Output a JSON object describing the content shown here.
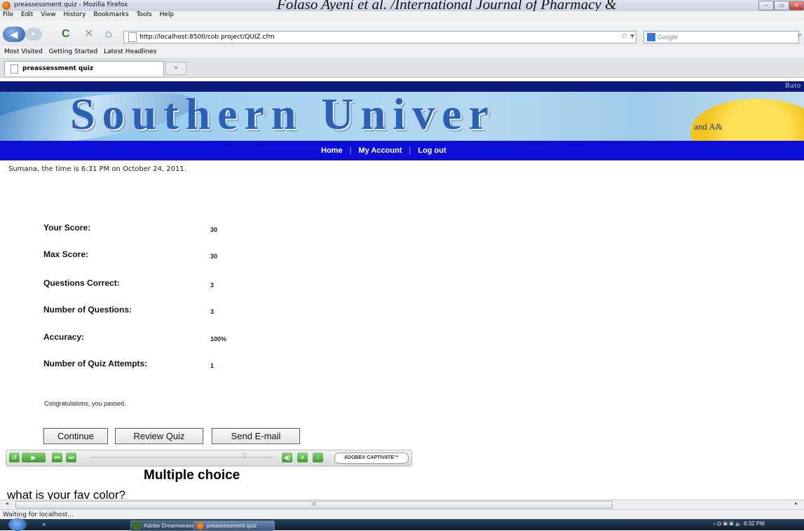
{
  "header_overlay": "Folaso Ayeni  et al. /International Journal of Pharmacy &",
  "window": {
    "title": "preassessment quiz - Mozilla Firefox",
    "controls": [
      "–",
      "▭",
      "✕"
    ]
  },
  "menu": [
    "File",
    "Edit",
    "View",
    "History",
    "Bookmarks",
    "Tools",
    "Help"
  ],
  "toolbar": {
    "back_icon": "◀",
    "forward_icon": "▸",
    "reload_icon": "C",
    "stop_icon": "✕",
    "home_icon": "⌂",
    "url": "http://localhost:8500/cob project/QUIZ.cfm",
    "star_icon": "☆ ▾",
    "search_placeholder": "Google",
    "search_go_icon": "⌕"
  },
  "bookmarks": [
    "Most Visited",
    "Getting Started",
    "Latest Headlines"
  ],
  "tab": {
    "label": "preassessment quiz",
    "new_tab_icon": "+"
  },
  "site": {
    "top_strip_text": "Bato",
    "banner_name": "Southern Univer",
    "banner_sub": "and A&",
    "nav": [
      "Home",
      "My Account",
      "Log out"
    ],
    "nav_sep": "|",
    "greeting": "Sumana, the time is 6:31 PM on October 24, 2011."
  },
  "results": {
    "rows": [
      {
        "label": "Your Score:",
        "value": "30"
      },
      {
        "label": "Max Score:",
        "value": "30"
      },
      {
        "label": "Questions Correct:",
        "value": "3"
      },
      {
        "label": "Number of Questions:",
        "value": "3"
      },
      {
        "label": "Accuracy:",
        "value": "100%"
      },
      {
        "label": "Number of Quiz Attempts:",
        "value": "1"
      }
    ],
    "message": "Congratulations, you passed."
  },
  "buttons": {
    "continue": "Continue",
    "review": "Review Quiz",
    "email": "Send E-mail"
  },
  "captivate": {
    "rewind_icon": "↺",
    "play_icon": "▶",
    "prev_icon": "⏮",
    "next_icon": "⏭",
    "knob": "▽",
    "volume_icon": "◀)",
    "close_icon": "✕",
    "info_icon": "i",
    "brand": "ADOBE® CAPTIVATE™"
  },
  "quiz": {
    "heading": "Multiple choice",
    "question": "what is your fav color?"
  },
  "scrollbar": {
    "left_arrow": "◂",
    "right_arrow": "▸",
    "grip": "III"
  },
  "status": "Waiting for localhost...",
  "taskbar": {
    "quick": "»",
    "items": [
      "Adobe Dreamweave...",
      "preassessment quiz"
    ],
    "tray": "‹ ⛭ ▣  ▣ 🔈 6:32 PM"
  },
  "colors": {
    "nav_blue": "#0d0dd8",
    "top_strip": "#0b1a78",
    "banner_text": "#2a61b4"
  }
}
